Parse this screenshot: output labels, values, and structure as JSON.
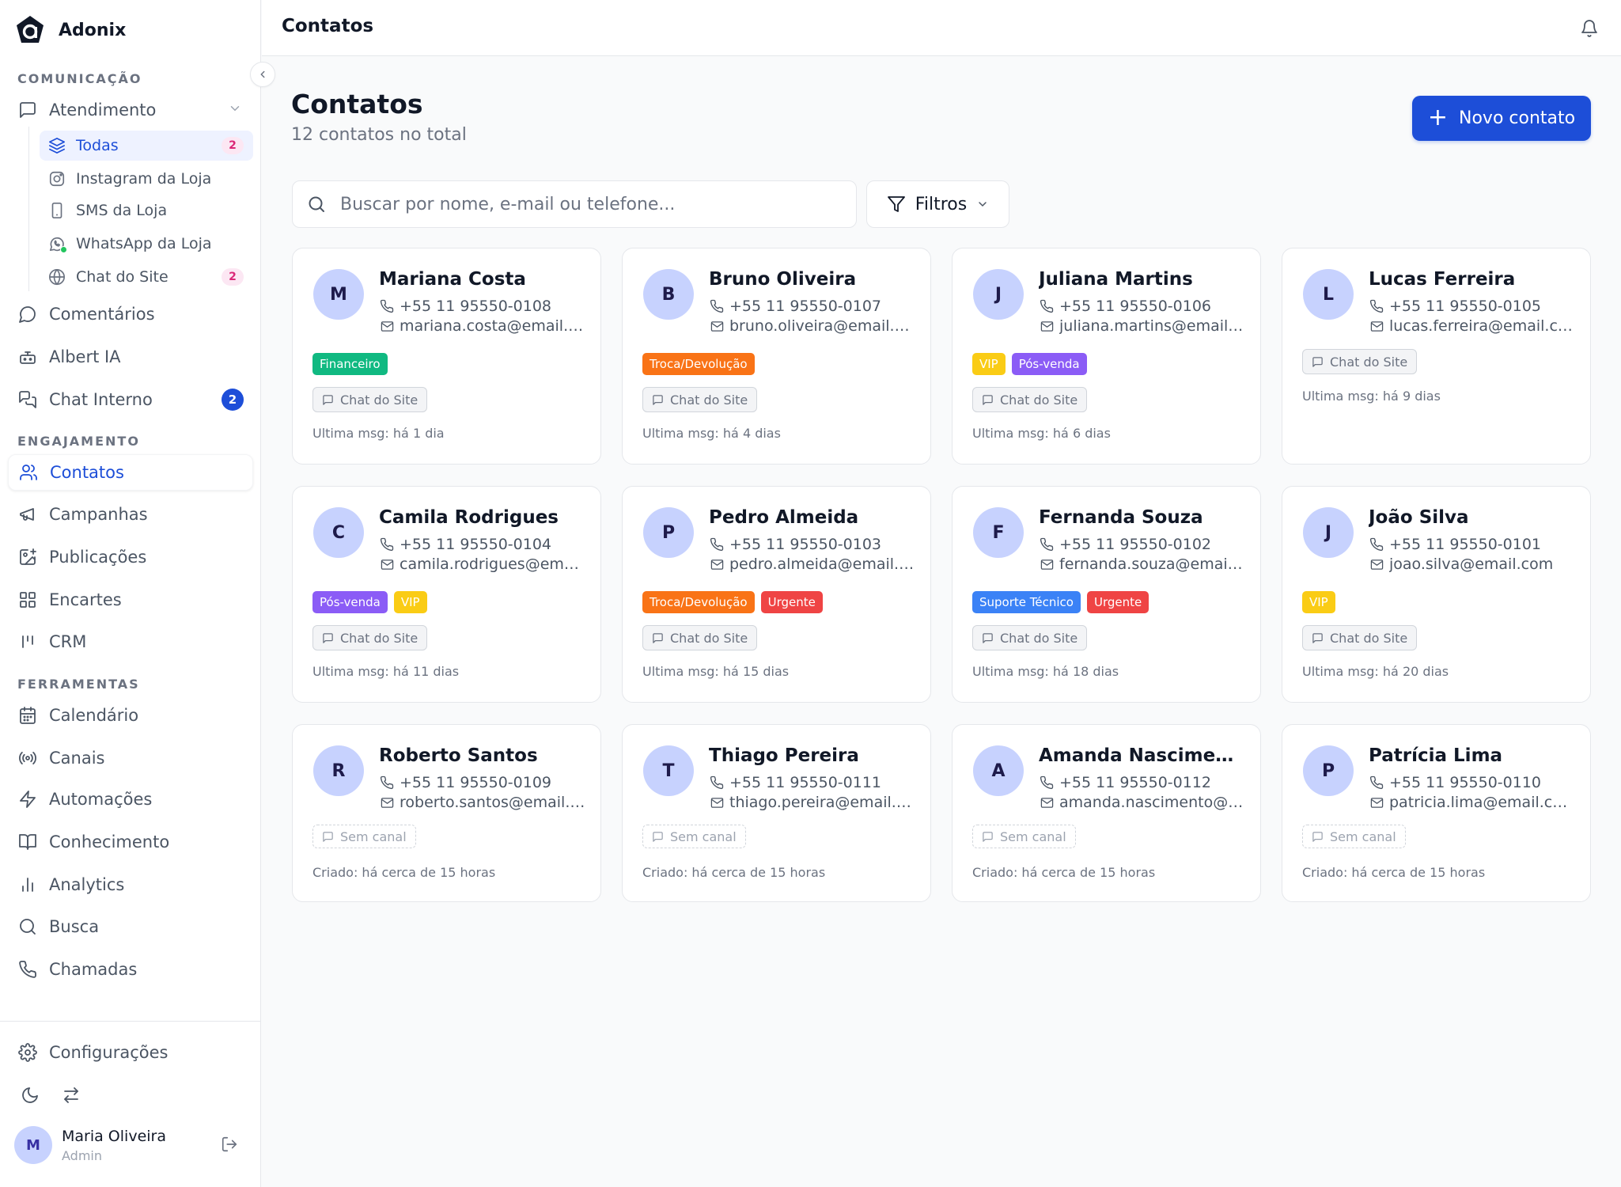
{
  "app": {
    "name": "Adonix"
  },
  "sidebar": {
    "sections": {
      "comunicacao": "COMUNICAÇÃO",
      "engajamento": "ENGAJAMENTO",
      "ferramentas": "FERRAMENTAS"
    },
    "atendimento": {
      "label": "Atendimento",
      "icon": "message-square-icon"
    },
    "sub_items": [
      {
        "label": "Todas",
        "icon": "layers-icon",
        "badge": "2"
      },
      {
        "label": "Instagram da Loja",
        "icon": "instagram-icon"
      },
      {
        "label": "SMS da Loja",
        "icon": "smartphone-icon"
      },
      {
        "label": "WhatsApp da Loja",
        "icon": "whatsapp-icon"
      },
      {
        "label": "Chat do Site",
        "icon": "globe-icon",
        "badge": "2"
      }
    ],
    "comunicacao_items": [
      {
        "label": "Comentários",
        "icon": "message-circle-icon"
      },
      {
        "label": "Albert IA",
        "icon": "bot-icon"
      },
      {
        "label": "Chat Interno",
        "icon": "messages-icon",
        "badge": "2"
      }
    ],
    "engajamento_items": [
      {
        "label": "Contatos",
        "icon": "users-icon"
      },
      {
        "label": "Campanhas",
        "icon": "megaphone-icon"
      },
      {
        "label": "Publicações",
        "icon": "image-plus-icon"
      },
      {
        "label": "Encartes",
        "icon": "grid-icon"
      },
      {
        "label": "CRM",
        "icon": "kanban-icon"
      }
    ],
    "ferramentas_items": [
      {
        "label": "Calendário",
        "icon": "calendar-icon"
      },
      {
        "label": "Canais",
        "icon": "radio-icon"
      },
      {
        "label": "Automações",
        "icon": "zap-icon"
      },
      {
        "label": "Conhecimento",
        "icon": "book-open-icon"
      },
      {
        "label": "Analytics",
        "icon": "bar-chart-icon"
      },
      {
        "label": "Busca",
        "icon": "search-icon"
      },
      {
        "label": "Chamadas",
        "icon": "phone-icon"
      }
    ],
    "settings": {
      "label": "Configurações",
      "icon": "settings-icon"
    },
    "user": {
      "initial": "M",
      "name": "Maria Oliveira",
      "role": "Admin"
    }
  },
  "topbar": {
    "title": "Contatos"
  },
  "main": {
    "title": "Contatos",
    "subtitle": "12 contatos no total",
    "new_button": "Novo contato",
    "search_placeholder": "Buscar por nome, e-mail ou telefone...",
    "filter_label": "Filtros"
  },
  "tag_colors": {
    "Financeiro": "#10b981",
    "Troca/Devolução": "#f97316",
    "VIP": "#facc15",
    "Pós-venda": "#8b5cf6",
    "Urgente": "#ef4444",
    "Suporte Técnico": "#3b82f6"
  },
  "contacts": [
    {
      "initial": "M",
      "name": "Mariana Costa",
      "phone": "+55 11 95550-0108",
      "email": "mariana.costa@email.com",
      "tags": [
        "Financeiro"
      ],
      "channel": "Chat do Site",
      "meta": "Ultima msg: há 1 dia"
    },
    {
      "initial": "B",
      "name": "Bruno Oliveira",
      "phone": "+55 11 95550-0107",
      "email": "bruno.oliveira@email.com",
      "tags": [
        "Troca/Devolução"
      ],
      "channel": "Chat do Site",
      "meta": "Ultima msg: há 4 dias"
    },
    {
      "initial": "J",
      "name": "Juliana Martins",
      "phone": "+55 11 95550-0106",
      "email": "juliana.martins@email.com",
      "tags": [
        "VIP",
        "Pós-venda"
      ],
      "channel": "Chat do Site",
      "meta": "Ultima msg: há 6 dias"
    },
    {
      "initial": "L",
      "name": "Lucas Ferreira",
      "phone": "+55 11 95550-0105",
      "email": "lucas.ferreira@email.com",
      "tags": [],
      "channel": "Chat do Site",
      "meta": "Ultima msg: há 9 dias"
    },
    {
      "initial": "C",
      "name": "Camila Rodrigues",
      "phone": "+55 11 95550-0104",
      "email": "camila.rodrigues@email.com",
      "tags": [
        "Pós-venda",
        "VIP"
      ],
      "channel": "Chat do Site",
      "meta": "Ultima msg: há 11 dias"
    },
    {
      "initial": "P",
      "name": "Pedro Almeida",
      "phone": "+55 11 95550-0103",
      "email": "pedro.almeida@email.com",
      "tags": [
        "Troca/Devolução",
        "Urgente"
      ],
      "channel": "Chat do Site",
      "meta": "Ultima msg: há 15 dias"
    },
    {
      "initial": "F",
      "name": "Fernanda Souza",
      "phone": "+55 11 95550-0102",
      "email": "fernanda.souza@email.com",
      "tags": [
        "Suporte Técnico",
        "Urgente"
      ],
      "channel": "Chat do Site",
      "meta": "Ultima msg: há 18 dias"
    },
    {
      "initial": "J",
      "name": "João Silva",
      "phone": "+55 11 95550-0101",
      "email": "joao.silva@email.com",
      "tags": [
        "VIP"
      ],
      "channel": "Chat do Site",
      "meta": "Ultima msg: há 20 dias"
    },
    {
      "initial": "R",
      "name": "Roberto Santos",
      "phone": "+55 11 95550-0109",
      "email": "roberto.santos@email.com",
      "tags": [],
      "channel": "Sem canal",
      "meta": "Criado: há cerca de 15 horas"
    },
    {
      "initial": "T",
      "name": "Thiago Pereira",
      "phone": "+55 11 95550-0111",
      "email": "thiago.pereira@email.com",
      "tags": [],
      "channel": "Sem canal",
      "meta": "Criado: há cerca de 15 horas"
    },
    {
      "initial": "A",
      "name": "Amanda Nascimento",
      "phone": "+55 11 95550-0112",
      "email": "amanda.nascimento@email.com",
      "tags": [],
      "channel": "Sem canal",
      "meta": "Criado: há cerca de 15 horas"
    },
    {
      "initial": "P",
      "name": "Patrícia Lima",
      "phone": "+55 11 95550-0110",
      "email": "patricia.lima@email.com",
      "tags": [],
      "channel": "Sem canal",
      "meta": "Criado: há cerca de 15 horas"
    }
  ]
}
